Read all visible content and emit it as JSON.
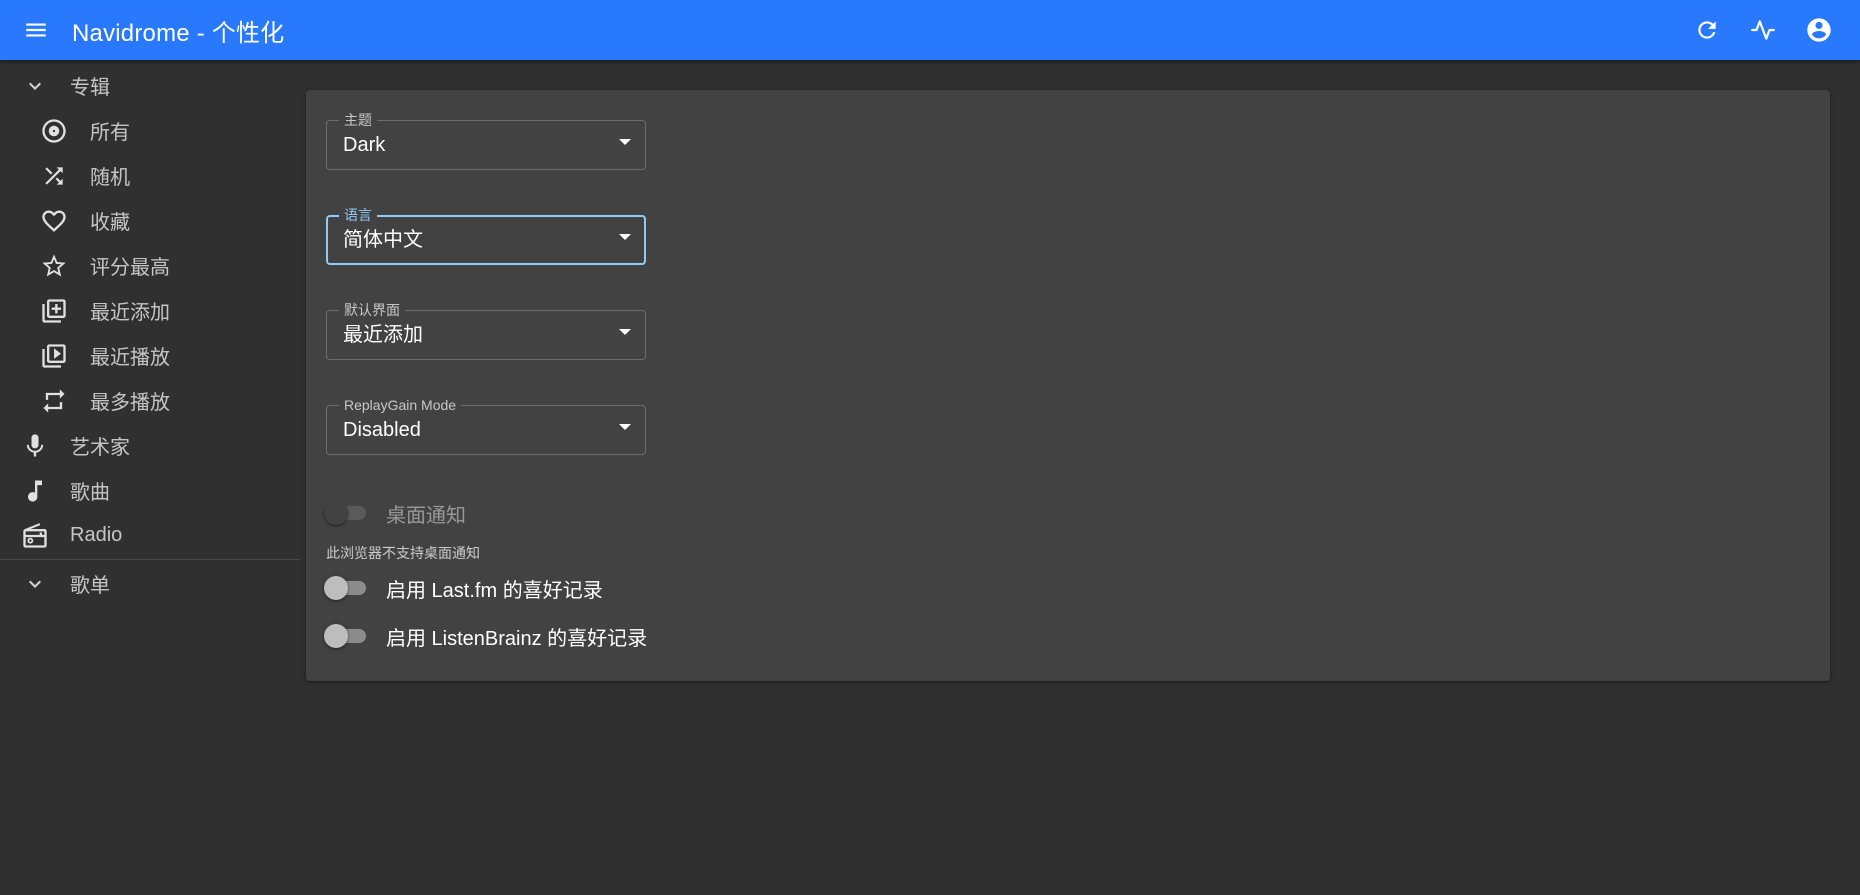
{
  "app": {
    "title": "Navidrome - 个性化"
  },
  "colors": {
    "appbar": "#2979ff",
    "background": "#303030",
    "card": "#424242",
    "focus": "#90caf9"
  },
  "sidebar": {
    "album_section": "专辑",
    "album_items": [
      {
        "label": "所有",
        "icon": "album-disc-icon"
      },
      {
        "label": "随机",
        "icon": "shuffle-icon"
      },
      {
        "label": "收藏",
        "icon": "heart-icon"
      },
      {
        "label": "评分最高",
        "icon": "star-icon"
      },
      {
        "label": "最近添加",
        "icon": "library-add-icon"
      },
      {
        "label": "最近播放",
        "icon": "video-library-icon"
      },
      {
        "label": "最多播放",
        "icon": "repeat-icon"
      }
    ],
    "artist": "艺术家",
    "songs": "歌曲",
    "radio": "Radio",
    "playlist_section": "歌单"
  },
  "settings": {
    "theme": {
      "label": "主题",
      "value": "Dark"
    },
    "language": {
      "label": "语言",
      "value": "简体中文"
    },
    "default_view": {
      "label": "默认界面",
      "value": "最近添加"
    },
    "replaygain": {
      "label": "ReplayGain Mode",
      "value": "Disabled"
    },
    "desktop_notifications": {
      "label": "桌面通知",
      "helper": "此浏览器不支持桌面通知",
      "enabled": false
    },
    "lastfm": {
      "label": "启用 Last.fm 的喜好记录",
      "enabled": false
    },
    "listenbrainz": {
      "label": "启用 ListenBrainz 的喜好记录",
      "enabled": false
    }
  }
}
